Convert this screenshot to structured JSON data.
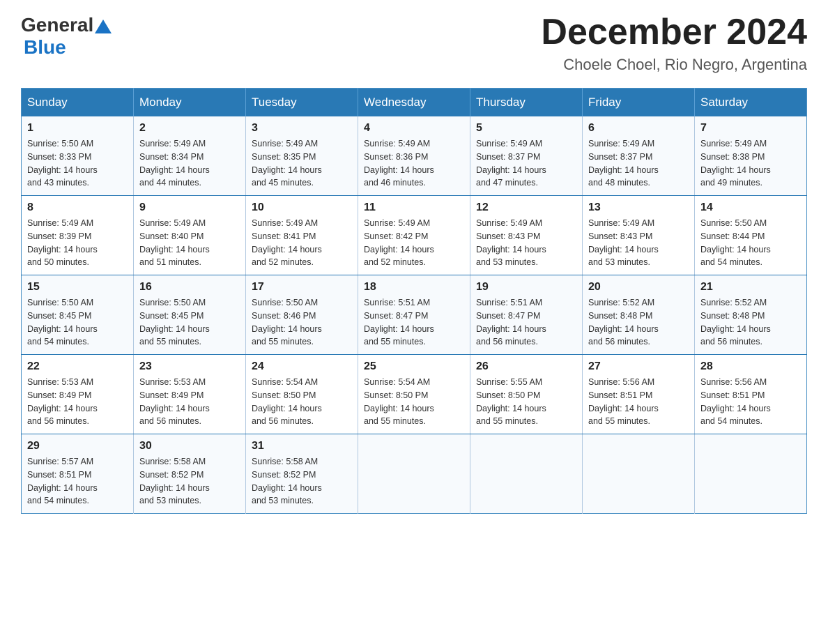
{
  "logo": {
    "general": "General",
    "blue": "Blue"
  },
  "header": {
    "month": "December 2024",
    "location": "Choele Choel, Rio Negro, Argentina"
  },
  "weekdays": [
    "Sunday",
    "Monday",
    "Tuesday",
    "Wednesday",
    "Thursday",
    "Friday",
    "Saturday"
  ],
  "weeks": [
    [
      {
        "day": "1",
        "sunrise": "5:50 AM",
        "sunset": "8:33 PM",
        "daylight": "14 hours and 43 minutes."
      },
      {
        "day": "2",
        "sunrise": "5:49 AM",
        "sunset": "8:34 PM",
        "daylight": "14 hours and 44 minutes."
      },
      {
        "day": "3",
        "sunrise": "5:49 AM",
        "sunset": "8:35 PM",
        "daylight": "14 hours and 45 minutes."
      },
      {
        "day": "4",
        "sunrise": "5:49 AM",
        "sunset": "8:36 PM",
        "daylight": "14 hours and 46 minutes."
      },
      {
        "day": "5",
        "sunrise": "5:49 AM",
        "sunset": "8:37 PM",
        "daylight": "14 hours and 47 minutes."
      },
      {
        "day": "6",
        "sunrise": "5:49 AM",
        "sunset": "8:37 PM",
        "daylight": "14 hours and 48 minutes."
      },
      {
        "day": "7",
        "sunrise": "5:49 AM",
        "sunset": "8:38 PM",
        "daylight": "14 hours and 49 minutes."
      }
    ],
    [
      {
        "day": "8",
        "sunrise": "5:49 AM",
        "sunset": "8:39 PM",
        "daylight": "14 hours and 50 minutes."
      },
      {
        "day": "9",
        "sunrise": "5:49 AM",
        "sunset": "8:40 PM",
        "daylight": "14 hours and 51 minutes."
      },
      {
        "day": "10",
        "sunrise": "5:49 AM",
        "sunset": "8:41 PM",
        "daylight": "14 hours and 52 minutes."
      },
      {
        "day": "11",
        "sunrise": "5:49 AM",
        "sunset": "8:42 PM",
        "daylight": "14 hours and 52 minutes."
      },
      {
        "day": "12",
        "sunrise": "5:49 AM",
        "sunset": "8:43 PM",
        "daylight": "14 hours and 53 minutes."
      },
      {
        "day": "13",
        "sunrise": "5:49 AM",
        "sunset": "8:43 PM",
        "daylight": "14 hours and 53 minutes."
      },
      {
        "day": "14",
        "sunrise": "5:50 AM",
        "sunset": "8:44 PM",
        "daylight": "14 hours and 54 minutes."
      }
    ],
    [
      {
        "day": "15",
        "sunrise": "5:50 AM",
        "sunset": "8:45 PM",
        "daylight": "14 hours and 54 minutes."
      },
      {
        "day": "16",
        "sunrise": "5:50 AM",
        "sunset": "8:45 PM",
        "daylight": "14 hours and 55 minutes."
      },
      {
        "day": "17",
        "sunrise": "5:50 AM",
        "sunset": "8:46 PM",
        "daylight": "14 hours and 55 minutes."
      },
      {
        "day": "18",
        "sunrise": "5:51 AM",
        "sunset": "8:47 PM",
        "daylight": "14 hours and 55 minutes."
      },
      {
        "day": "19",
        "sunrise": "5:51 AM",
        "sunset": "8:47 PM",
        "daylight": "14 hours and 56 minutes."
      },
      {
        "day": "20",
        "sunrise": "5:52 AM",
        "sunset": "8:48 PM",
        "daylight": "14 hours and 56 minutes."
      },
      {
        "day": "21",
        "sunrise": "5:52 AM",
        "sunset": "8:48 PM",
        "daylight": "14 hours and 56 minutes."
      }
    ],
    [
      {
        "day": "22",
        "sunrise": "5:53 AM",
        "sunset": "8:49 PM",
        "daylight": "14 hours and 56 minutes."
      },
      {
        "day": "23",
        "sunrise": "5:53 AM",
        "sunset": "8:49 PM",
        "daylight": "14 hours and 56 minutes."
      },
      {
        "day": "24",
        "sunrise": "5:54 AM",
        "sunset": "8:50 PM",
        "daylight": "14 hours and 56 minutes."
      },
      {
        "day": "25",
        "sunrise": "5:54 AM",
        "sunset": "8:50 PM",
        "daylight": "14 hours and 55 minutes."
      },
      {
        "day": "26",
        "sunrise": "5:55 AM",
        "sunset": "8:50 PM",
        "daylight": "14 hours and 55 minutes."
      },
      {
        "day": "27",
        "sunrise": "5:56 AM",
        "sunset": "8:51 PM",
        "daylight": "14 hours and 55 minutes."
      },
      {
        "day": "28",
        "sunrise": "5:56 AM",
        "sunset": "8:51 PM",
        "daylight": "14 hours and 54 minutes."
      }
    ],
    [
      {
        "day": "29",
        "sunrise": "5:57 AM",
        "sunset": "8:51 PM",
        "daylight": "14 hours and 54 minutes."
      },
      {
        "day": "30",
        "sunrise": "5:58 AM",
        "sunset": "8:52 PM",
        "daylight": "14 hours and 53 minutes."
      },
      {
        "day": "31",
        "sunrise": "5:58 AM",
        "sunset": "8:52 PM",
        "daylight": "14 hours and 53 minutes."
      },
      null,
      null,
      null,
      null
    ]
  ],
  "labels": {
    "sunrise": "Sunrise:",
    "sunset": "Sunset:",
    "daylight": "Daylight:"
  }
}
